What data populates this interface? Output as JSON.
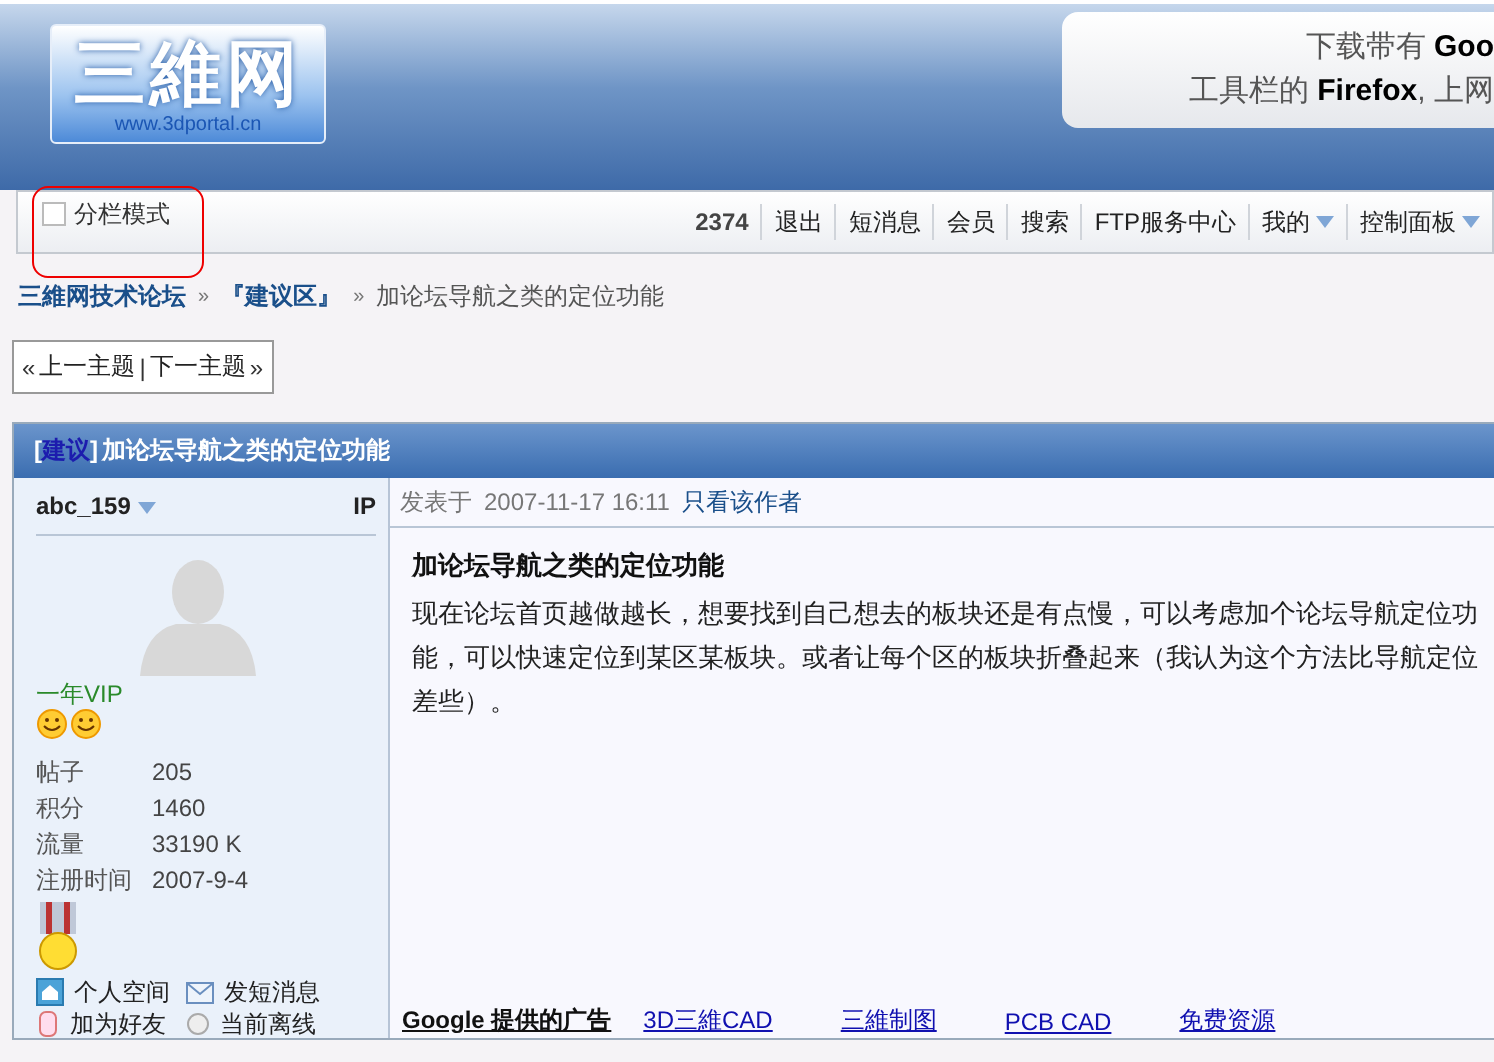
{
  "header": {
    "logo": {
      "title": "三維网",
      "url": "www.3dportal.cn"
    },
    "banner": {
      "lines": [
        "下载带有 **Goo**",
        "工具栏的 **Firefox**, 上网"
      ]
    }
  },
  "toolbar": {
    "column_mode": {
      "label": "分栏模式",
      "checked": false
    },
    "items": [
      {
        "label": "2374",
        "kind": "count",
        "dropdown": false
      },
      {
        "label": "退出",
        "kind": "link",
        "dropdown": false
      },
      {
        "label": "短消息",
        "kind": "link",
        "dropdown": false
      },
      {
        "label": "会员",
        "kind": "link",
        "dropdown": false
      },
      {
        "label": "搜索",
        "kind": "link",
        "dropdown": false
      },
      {
        "label": "FTP服务中心",
        "kind": "link",
        "dropdown": false
      },
      {
        "label": "我的",
        "kind": "link",
        "dropdown": true
      },
      {
        "label": "控制面板",
        "kind": "link",
        "dropdown": true
      }
    ]
  },
  "breadcrumb": [
    {
      "label": "三維网技术论坛",
      "kind": "link"
    },
    {
      "separator": "»",
      "label": "『建议区』",
      "kind": "link"
    },
    {
      "separator": "»",
      "label": "加论坛导航之类的定位功能",
      "kind": "current"
    }
  ],
  "thread_nav": {
    "prev_arrow": "«",
    "prev": "上一主题",
    "divider": "|",
    "next": "下一主题",
    "next_arrow": "»"
  },
  "post": {
    "tag_open": "[",
    "tag": "建议",
    "tag_close": "]",
    "title": "加论坛导航之类的定位功能",
    "author": {
      "name": "abc_159",
      "ip": "IP",
      "group": "一年VIP",
      "stats": [
        {
          "label": "帖子",
          "value": "205"
        },
        {
          "label": "积分",
          "value": "1460"
        },
        {
          "label": "流量",
          "value": "33190 K"
        },
        {
          "label": "注册时间",
          "value": "2007-9-4"
        }
      ],
      "actions": [
        {
          "label": "个人空间",
          "kind": "home"
        },
        {
          "label": "发短消息",
          "kind": "mail"
        },
        {
          "label": "加为好友",
          "kind": "friend"
        },
        {
          "label": "当前离线",
          "kind": "offline"
        }
      ]
    },
    "meta": {
      "posted_label": "发表于",
      "time": "2007-11-17 16:11",
      "author_only": "只看该作者"
    },
    "subject": "加论坛导航之类的定位功能",
    "body": "现在论坛首页越做越长，想要找到自己想去的板块还是有点慢，可以考虑加个论坛导航定位功能，可以快速定位到某区某板块。或者让每个区的板块折叠起来（我认为这个方法比导航定位差些）。",
    "ads": {
      "label": "Google 提供的广告",
      "links": [
        "3D三維CAD",
        "三維制图",
        "PCB CAD",
        "免费资源"
      ]
    }
  }
}
